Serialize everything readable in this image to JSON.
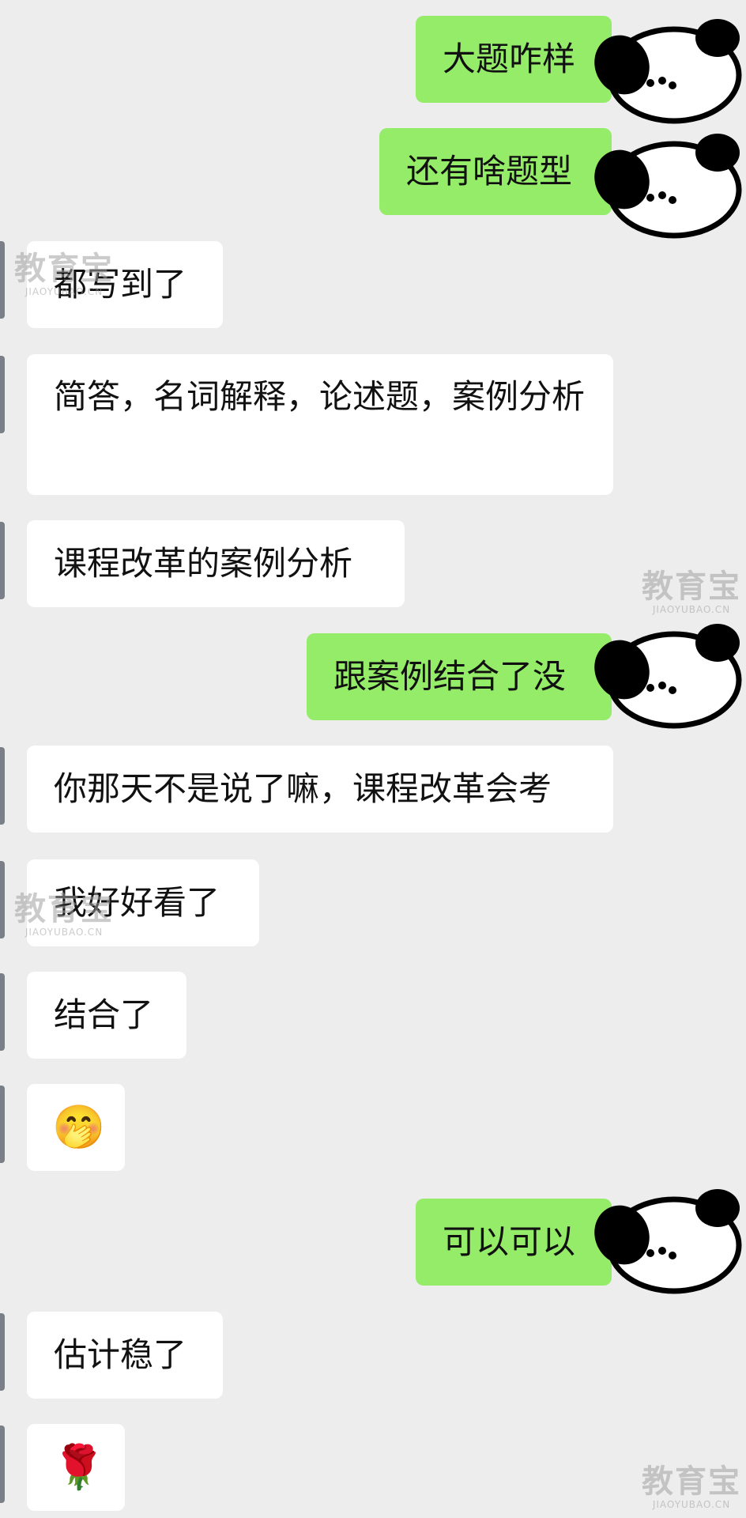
{
  "messages": [
    {
      "side": "out",
      "text": "大题咋样"
    },
    {
      "side": "out",
      "text": "还有啥题型"
    },
    {
      "side": "in",
      "text": "都写到了"
    },
    {
      "side": "in",
      "text": "简答，名词解释，论述题，案例分析"
    },
    {
      "side": "in",
      "text": "课程改革的案例分析"
    },
    {
      "side": "out",
      "text": "跟案例结合了没"
    },
    {
      "side": "in",
      "text": "你那天不是说了嘛，课程改革会考"
    },
    {
      "side": "in",
      "text": "我好好看了"
    },
    {
      "side": "in",
      "text": "结合了"
    },
    {
      "side": "in",
      "text": "🤭"
    },
    {
      "side": "out",
      "text": "可以可以"
    },
    {
      "side": "in",
      "text": "估计稳了"
    },
    {
      "side": "in",
      "text": "🌹"
    }
  ],
  "watermark": {
    "brand": "教育宝",
    "domain": "JIAOYUBAO.CN"
  },
  "avatar": {
    "name": "panda-avatar"
  },
  "colors": {
    "background": "#ededed",
    "bubble_in": "#ffffff",
    "bubble_out": "#95ec69"
  }
}
